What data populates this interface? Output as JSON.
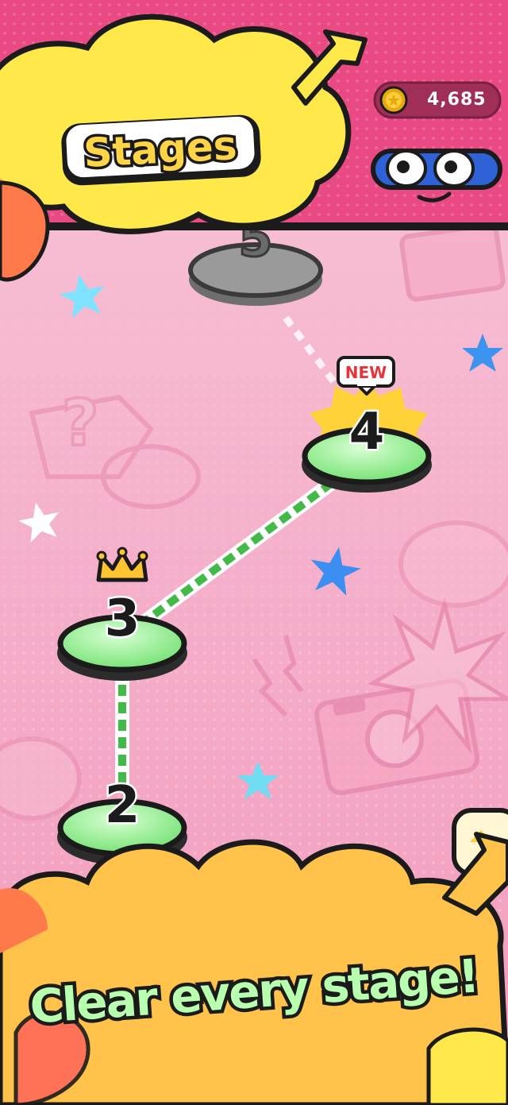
{
  "header": {
    "title": "Stages",
    "coins": "4,685"
  },
  "stages": [
    {
      "number": "2",
      "state": "cleared"
    },
    {
      "number": "3",
      "state": "cleared",
      "crown": true
    },
    {
      "number": "4",
      "state": "current",
      "badge": "NEW"
    },
    {
      "number": "5",
      "state": "locked"
    }
  ],
  "banner": {
    "text": "Clear every stage!"
  },
  "colors": {
    "header_bg": "#ea4a84",
    "bg_pink": "#f4a9c4",
    "cloud_yellow": "#ffe94a",
    "cloud_orange": "#ffc24a",
    "node_green": "#9cf59a",
    "path_green": "#48c24a",
    "banner_text": "#b8ffb0"
  }
}
